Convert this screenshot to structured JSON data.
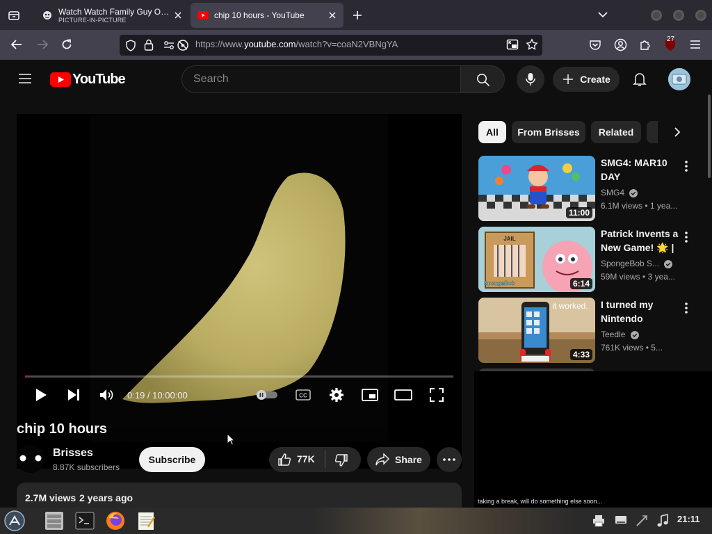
{
  "browser": {
    "tabs": [
      {
        "title": "Watch Watch Family Guy Onlin",
        "subtitle": "PICTURE-IN-PICTURE"
      },
      {
        "title": "chip 10 hours - YouTube"
      }
    ],
    "url_prefix": "https://www.",
    "url_domain": "youtube.com",
    "url_path": "/watch?v=coaN2VBNgYA",
    "extension_badge": "27"
  },
  "youtube": {
    "logo_text": "YouTube",
    "search_placeholder": "Search",
    "create_label": "Create",
    "player": {
      "time": "0:19 / 10:00:00",
      "progress": 0.0005
    },
    "video": {
      "title": "chip 10 hours",
      "channel": "Brisses",
      "subscribers": "8.87K subscribers",
      "subscribe_label": "Subscribe",
      "likes": "77K",
      "share_label": "Share",
      "views": "2.7M views",
      "age": "2 years ago"
    },
    "filters": [
      "All",
      "From Brisses",
      "Related"
    ],
    "related": [
      {
        "title": "SMG4: MAR10 DAY",
        "channel": "SMG4",
        "views": "6.1M views",
        "age": "1 yea...",
        "duration": "11:00"
      },
      {
        "title": "Patrick Invents a New Game! 🌟 | ...",
        "channel": "SpongeBob S...",
        "views": "59M views",
        "age": "3 yea...",
        "duration": "6:14"
      },
      {
        "title": "I turned my Nintendo Switc...",
        "channel": "Teedle",
        "views": "761K views",
        "age": "5...",
        "duration": "4:33"
      }
    ],
    "thumb_texts": {
      "jail": "JAIL",
      "spongebob": "SpongeBob",
      "worked": "it worked."
    },
    "pip_caption": "taking a break, will do something else soon..."
  },
  "taskbar": {
    "clock": "21:11"
  }
}
